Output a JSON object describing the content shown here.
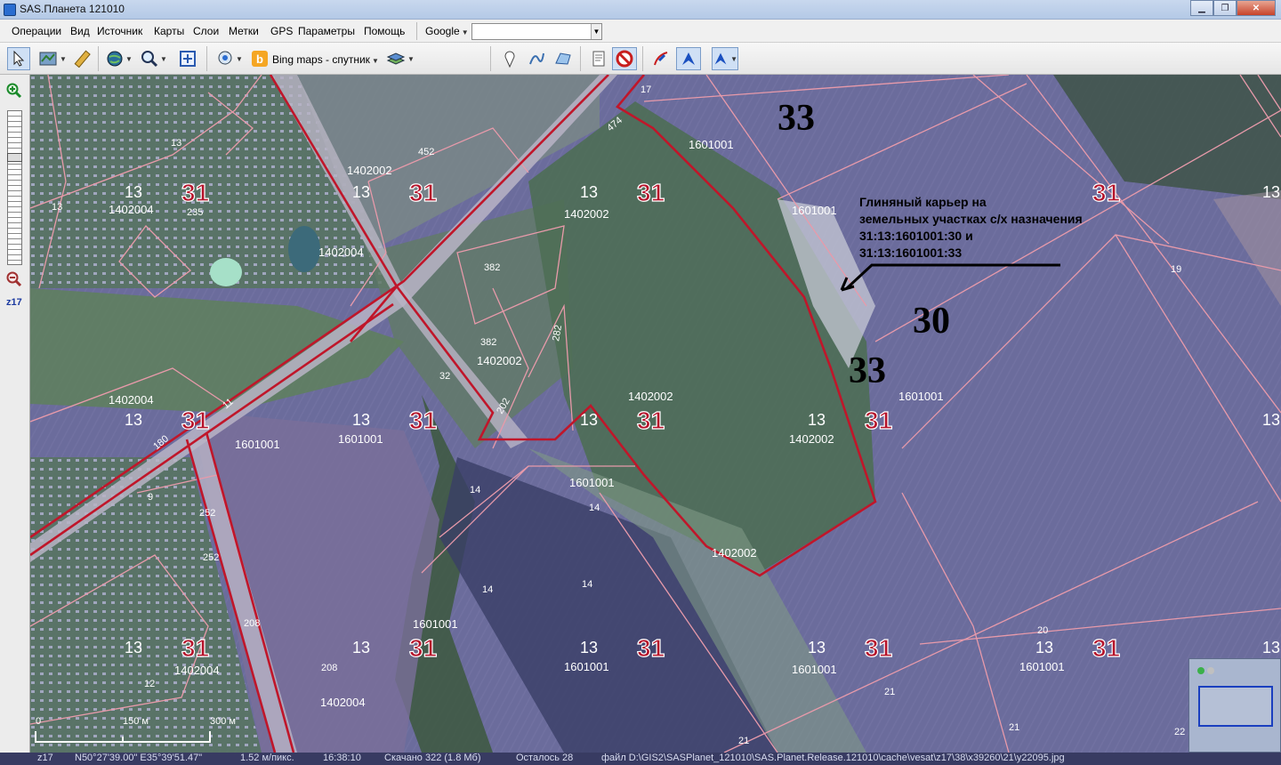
{
  "window": {
    "title": "SAS.Планета 121010",
    "minimize": "▁",
    "maximize": "❐",
    "close": "✕"
  },
  "menu": {
    "items": [
      "Операции",
      "Вид",
      "Источник",
      "Карты",
      "Слои",
      "Метки",
      "GPS",
      "Параметры",
      "Помощь"
    ],
    "geocoder": "Google",
    "search_value": ""
  },
  "toolbar": {
    "map_source": "Bing maps - спутник",
    "icons": [
      "cursor-icon",
      "map-layers-icon",
      "ruler-icon",
      "globe-icon",
      "magnifier-icon",
      "fullscreen-icon",
      "gps-icon",
      "bing-icon",
      "layers-icon",
      "placemark-icon",
      "path-icon",
      "polygon-icon",
      "marks-list-icon",
      "no-marks-icon",
      "gps-track-icon",
      "center-gps-icon",
      "gps-follow-icon"
    ]
  },
  "zoom": {
    "label": "z17"
  },
  "map": {
    "annotation": {
      "lines": [
        "Глиняный карьер на",
        "земельных участках с/х назначения",
        "31:13:1601001:30 и",
        "31:13:1601001:33"
      ]
    },
    "big_numbers": [
      "33",
      "30",
      "33"
    ],
    "district_labels": [
      "31",
      "13"
    ],
    "quarter_labels": [
      "1402002",
      "1402004",
      "1601001"
    ],
    "plot_numbers": [
      "17",
      "474",
      "452",
      "382",
      "282",
      "202",
      "235",
      "252",
      "208",
      "180",
      "11",
      "32",
      "14",
      "19",
      "20",
      "21",
      "22",
      "12",
      "9"
    ],
    "scale": {
      "zero": "0",
      "mid": "150 м",
      "end": "300 м"
    }
  },
  "status": {
    "zoom": "z17",
    "coords": "N50°27'39.00\" E35°39'51.47\"",
    "resolution": "1.52 м/пикс.",
    "time": "16:38:10",
    "downloaded": "Скачано 322 (1.8 Мб)",
    "remaining": "Осталось 28",
    "file": "файл D:\\GIS2\\SASPlanet_121010\\SAS.Planet.Release.121010\\cache\\vesat\\z17\\38\\x39260\\21\\y22095.jpg"
  },
  "colors": {
    "map_bg": "#6b6b9a",
    "parcel_line": "#e88fa0",
    "boundary_red": "#c0162a",
    "label_white": "#ffffff",
    "district_red": "#b5122a"
  }
}
